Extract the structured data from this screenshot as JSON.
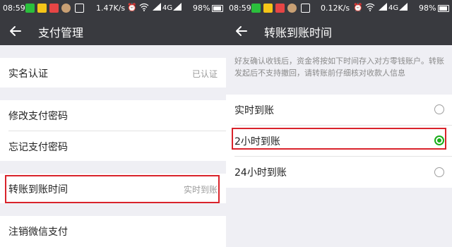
{
  "left": {
    "status_bar": {
      "time": "08:59",
      "speed": "1.47K/s",
      "battery": "98%"
    },
    "title": "支付管理",
    "rows": [
      {
        "label": "实名认证",
        "value": "已认证"
      },
      {
        "label": "修改支付密码",
        "value": ""
      },
      {
        "label": "忘记支付密码",
        "value": ""
      },
      {
        "label": "转账到账时间",
        "value": "实时到账"
      },
      {
        "label": "注销微信支付",
        "value": ""
      }
    ]
  },
  "right": {
    "status_bar": {
      "time": "08:59",
      "speed": "0.12K/s",
      "battery": "98%"
    },
    "title": "转账到账时间",
    "description": "好友确认收钱后，资金将按如下时间存入对方零钱账户。转账发起后不支持撤回，请转账前仔细核对收款人信息",
    "options": [
      {
        "label": "实时到账",
        "selected": false
      },
      {
        "label": "2小时到账",
        "selected": true
      },
      {
        "label": "24小时到账",
        "selected": false
      }
    ]
  },
  "colors": {
    "nav_bg": "#393a3f",
    "accent_green": "#1aad19",
    "highlight_red": "#d9232b"
  },
  "icons": {
    "back": "arrow-left-icon",
    "radio_on": "radio-checked-icon",
    "radio_off": "radio-unchecked-icon"
  }
}
